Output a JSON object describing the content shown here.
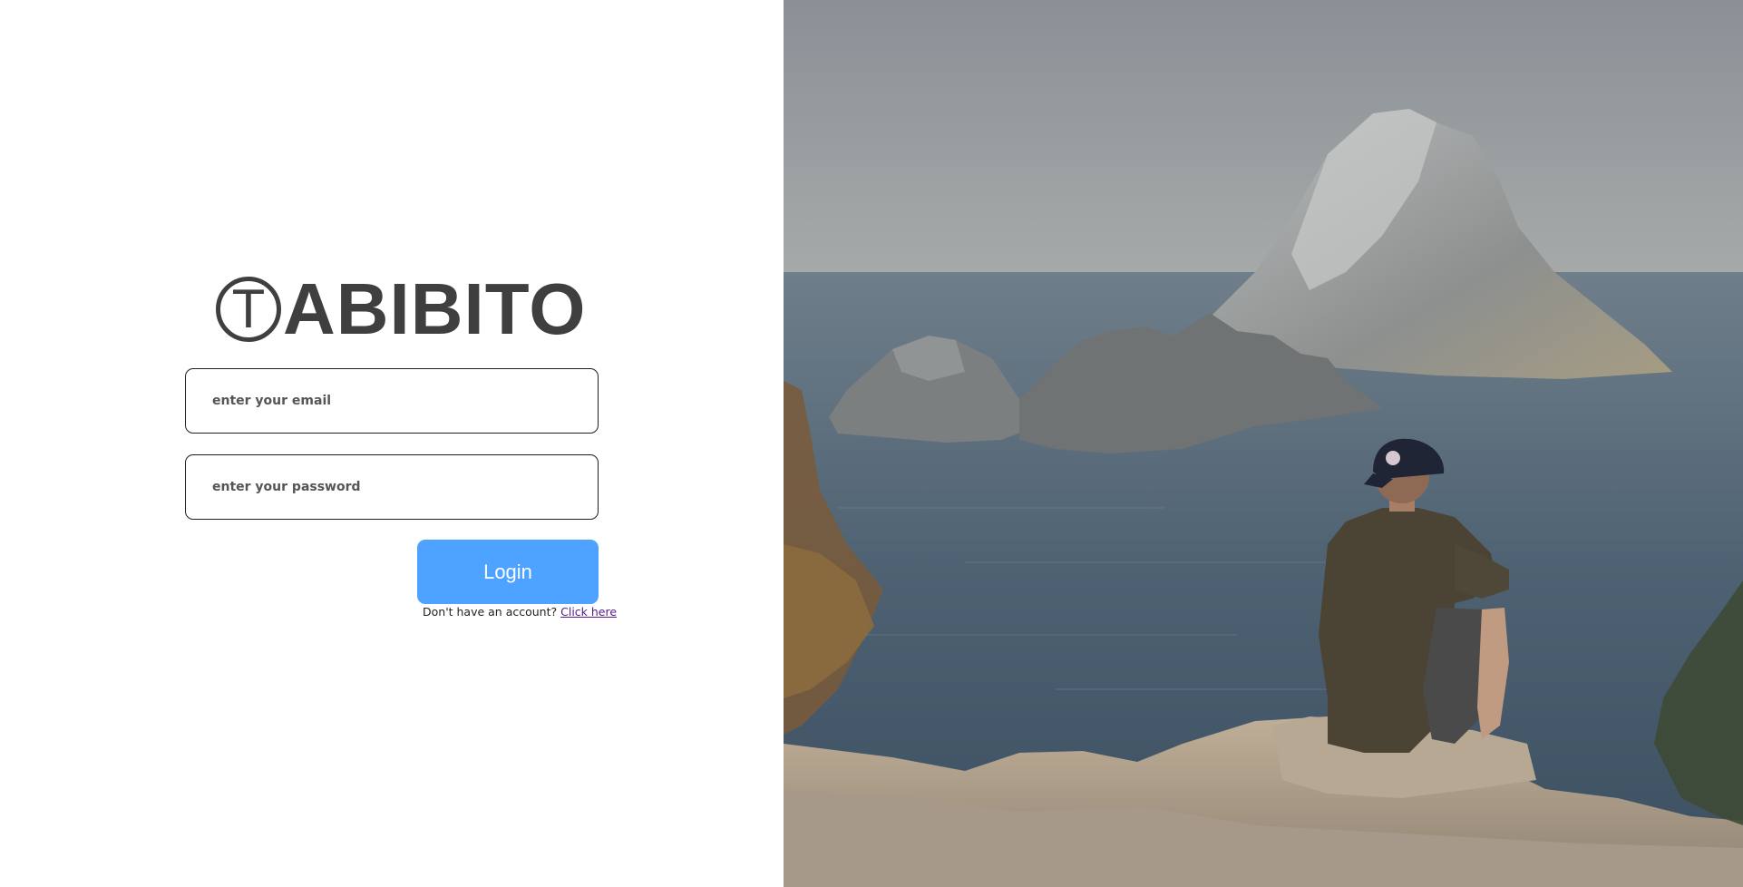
{
  "brand": {
    "logo_initial": "T",
    "logo_rest": "ABIBITO"
  },
  "form": {
    "email_placeholder": "enter your email",
    "password_placeholder": "enter your password",
    "login_label": "Login",
    "signup_prompt": "Don't have an account?",
    "signup_link": "Click here"
  },
  "colors": {
    "logo": "#3f3f3f",
    "login_button": "#4da3ff",
    "link_visited": "#551a8b"
  },
  "hero_image": {
    "alt": "person sitting on a cliff looking at rocky islands in the sea"
  }
}
